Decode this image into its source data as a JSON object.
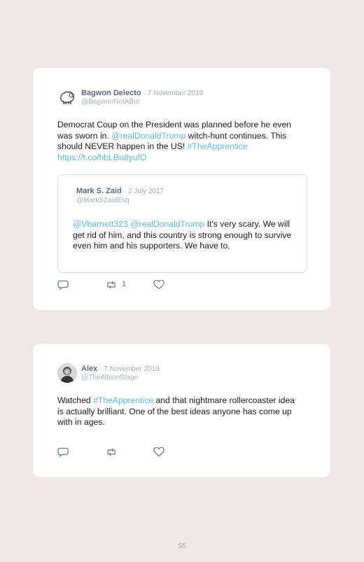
{
  "tweets": [
    {
      "name": "Bagwon Delecto",
      "date": "· 7 November 2019",
      "handle": "@BagwonNotABot",
      "text_1": "Democrat Coup on the President was planned before he even was sworn in. ",
      "mention_1": "@realDonaldTrump",
      "text_2": " witch-hunt continues. This should NEVER happen in the US! ",
      "hashtag": "#TheApprentice",
      "url": "https://t.co/hbLBo8yufO",
      "retweet_count": "1",
      "avatar_icon": "sheep-avatar-icon",
      "quote": {
        "name": "Mark S. Zaid",
        "date": "· 2 July 2017",
        "handle": "@MarkSZaidEsq",
        "mention_1": "@Vbarnett323",
        "mention_2": "@realDonaldTrump",
        "text": " It's very scary. We will get rid of him, and this country is strong enough to survive even him and his supporters. We have to."
      }
    },
    {
      "name": "Alex",
      "date": "· 7 November 2019",
      "handle": "@TheAlbionStage",
      "text_1": "Watched ",
      "hashtag": "#TheApprentice",
      "text_2": " and that nightmare rollercoaster idea is actually brilliant. One of the best ideas anyone has come up with in ages.",
      "avatar_icon": "person-avatar-icon"
    }
  ],
  "page_number": "55",
  "colors": {
    "background": "#f0e6e6",
    "card": "#ffffff",
    "link": "#5bb7e6",
    "icon": "#6a7580"
  }
}
